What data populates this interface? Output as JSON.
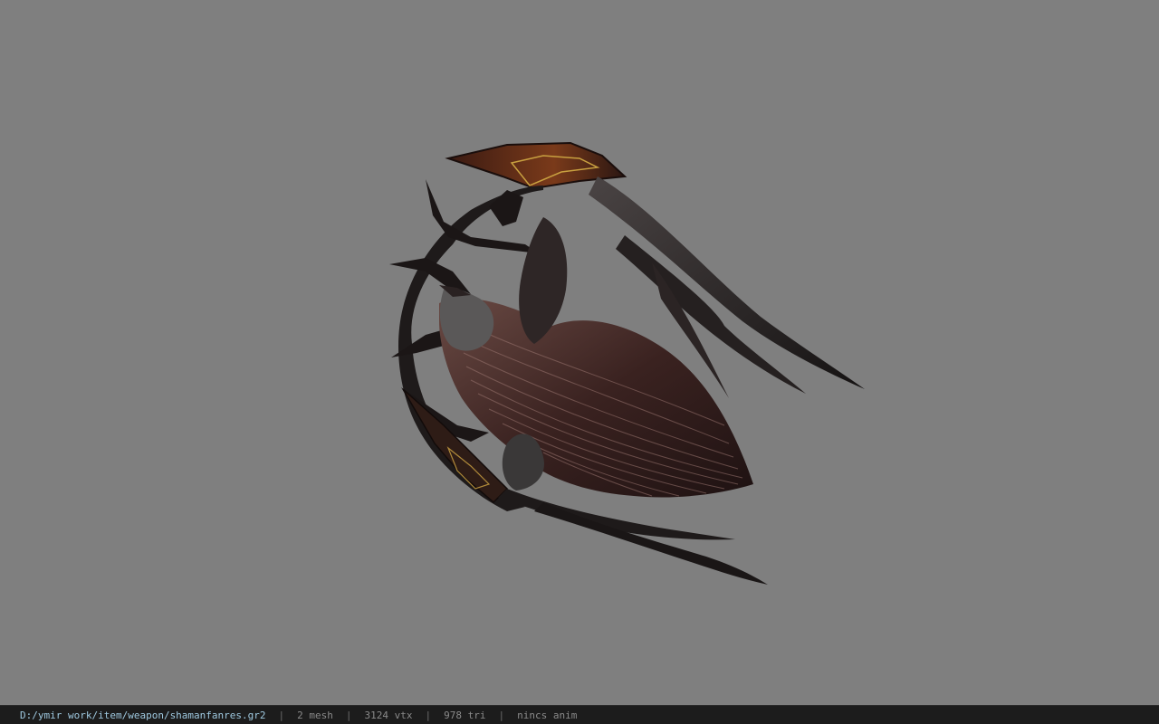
{
  "viewport": {
    "background": "#7f7f7f",
    "model_icon": "weapon-fan-model"
  },
  "status_bar": {
    "file_path": "D:/ymir work/item/weapon/shamanfanres.gr2",
    "separator": "|",
    "mesh_count": "2 mesh",
    "vertex_count": "3124 vtx",
    "triangle_count": "978 tri",
    "anim": "nincs anim"
  }
}
